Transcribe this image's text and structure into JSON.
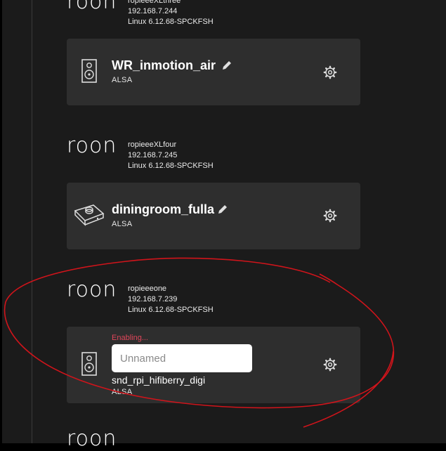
{
  "zones": [
    {
      "logo": "roon",
      "host": "ropieeeXLthree",
      "ip": "192.168.7.244",
      "os": "Linux 6.12.68-SPCKFSH",
      "device": {
        "name": "WR_inmotion_air",
        "subtitle": "ALSA",
        "icon": "speaker-icon"
      }
    },
    {
      "logo": "roon",
      "host": "ropieeeXLfour",
      "ip": "192.168.7.245",
      "os": "Linux 6.12.68-SPCKFSH",
      "device": {
        "name": "diningroom_fulla",
        "subtitle": "ALSA",
        "icon": "dac-icon"
      }
    },
    {
      "logo": "roon",
      "host": "ropieeeone",
      "ip": "192.168.7.239",
      "os": "Linux 6.12.68-SPCKFSH",
      "device": {
        "status": "Enabling...",
        "input_value": "",
        "input_placeholder": "Unnamed",
        "hardware_name": "snd_rpi_hifiberry_digi",
        "subtitle": "ALSA",
        "icon": "speaker-icon"
      }
    },
    {
      "logo": "roon"
    }
  ],
  "colors": {
    "background": "#1b1b1b",
    "card": "#2e2e2e",
    "status": "#e0465a",
    "annotation": "#d0141b"
  }
}
